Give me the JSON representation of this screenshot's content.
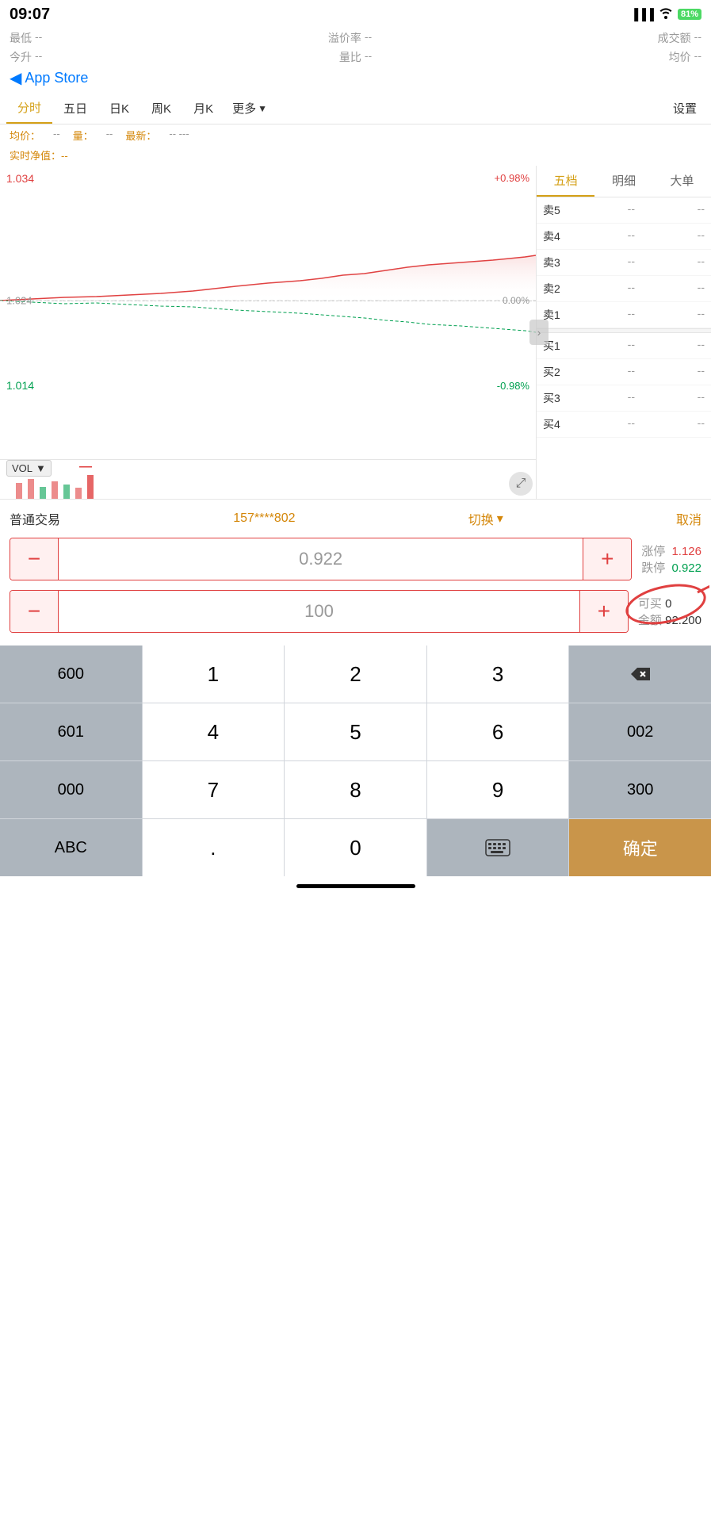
{
  "statusBar": {
    "time": "09:07",
    "battery": "81%"
  },
  "stockHeader": {
    "minLabel": "最低",
    "minVal": "--",
    "yzrLabel": "溢价率",
    "yzrVal": "--",
    "cjeLabel": "成交额",
    "cjeVal": "--",
    "todayLabel": "今升",
    "todayVal": "--",
    "lbLabel": "量比",
    "lbVal": "--",
    "avgLabel": "均价",
    "avgVal": "--"
  },
  "appStore": {
    "backLabel": "App Store"
  },
  "tabs": [
    {
      "label": "分时",
      "active": true
    },
    {
      "label": "五日"
    },
    {
      "label": "日K"
    },
    {
      "label": "周K"
    },
    {
      "label": "月K"
    },
    {
      "label": "更多",
      "hasArrow": true
    },
    {
      "label": "设置"
    }
  ],
  "infoBar": {
    "avgLabel": "均价：",
    "avgVal": "--",
    "volLabel": "量：",
    "volVal": "--",
    "latestLabel": "最新：",
    "latestVal": "-- ---"
  },
  "realtimeLabel": "实时净值：--",
  "chart": {
    "priceHigh": "1.034",
    "priceMid": "1.024",
    "priceLow": "1.014",
    "pctHigh": "+0.98%",
    "pctMid": "0.00%",
    "pctLow": "-0.98%",
    "volLabel": "VOL",
    "expandIcon": "↗↙"
  },
  "orderBook": {
    "tabs": [
      "五档",
      "明细",
      "大单"
    ],
    "activeTab": "五档",
    "sells": [
      {
        "label": "卖5",
        "qty": "--",
        "price": "--"
      },
      {
        "label": "卖4",
        "qty": "--",
        "price": "--"
      },
      {
        "label": "卖3",
        "qty": "--",
        "price": "--"
      },
      {
        "label": "卖2",
        "qty": "--",
        "price": "--"
      },
      {
        "label": "卖1",
        "qty": "--",
        "price": "--"
      }
    ],
    "buys": [
      {
        "label": "买1",
        "qty": "--",
        "price": "--"
      },
      {
        "label": "买2",
        "qty": "--",
        "price": "--"
      },
      {
        "label": "买3",
        "qty": "--",
        "price": "--"
      },
      {
        "label": "买4",
        "qty": "--",
        "price": "--"
      }
    ]
  },
  "trade": {
    "typeLabel": "普通交易",
    "account": "157****802",
    "switchLabel": "切换",
    "cancelLabel": "取消",
    "price": "0.922",
    "limitUp": "1.126",
    "limitDown": "0.922",
    "limitUpLabel": "涨停",
    "limitDownLabel": "跌停",
    "quantity": "100",
    "availableLabel": "可买",
    "availableVal": "0",
    "amountLabel": "金额",
    "amountVal": "92.200"
  },
  "numpad": {
    "rows": [
      [
        "600",
        "1",
        "2",
        "3",
        "⌫"
      ],
      [
        "601",
        "4",
        "5",
        "6",
        "002"
      ],
      [
        "000",
        "7",
        "8",
        "9",
        "300"
      ],
      [
        "ABC",
        ".",
        "0",
        "⌨",
        "确定"
      ]
    ]
  }
}
